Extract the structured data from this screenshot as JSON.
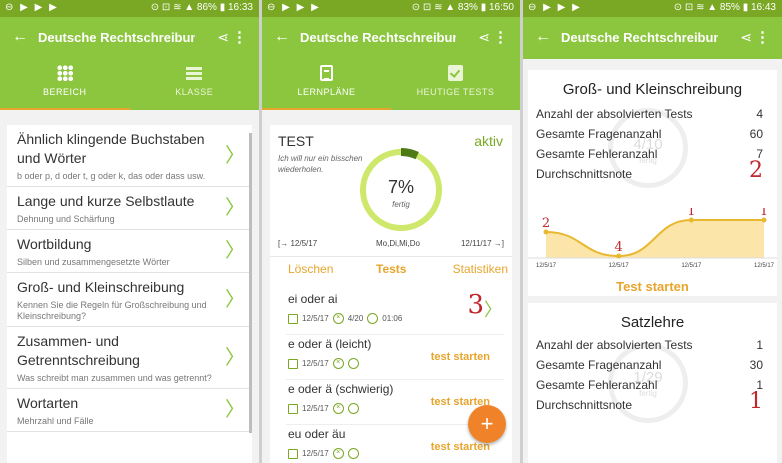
{
  "status_bars": [
    {
      "left": "⊖ ▶ ▶ ▶",
      "right": "⊙ ⊡ ≋ ▲ 86% ▮ 16:33"
    },
    {
      "left": "⊖ ▶ ▶ ▶",
      "right": "⊙ ⊡ ≋ ▲ 83% ▮ 16:50"
    },
    {
      "left": "⊖ ▶ ▶ ▶",
      "right": "⊙ ⊡ ≋ ▲ 85% ▮ 16:43"
    }
  ],
  "app_title": "Deutsche Rechtschreibung",
  "icons": {
    "back": "arrow-back-icon",
    "share": "share-icon",
    "more": "more-vert-icon"
  },
  "glyphs": {
    "back": "←",
    "share": "⋖",
    "more": "⋮",
    "chevron": "〉",
    "fab": "+",
    "arrow_start": "[→",
    "arrow_end": "→]"
  },
  "colors": {
    "primary": "#8cc63f",
    "status": "#7aa824",
    "accent": "#e8a52c",
    "red": "#c0262d",
    "fab": "#f0832a"
  },
  "panel1": {
    "tabs": [
      {
        "label": "BEREICH",
        "icon": "grid-icon",
        "active": true
      },
      {
        "label": "KLASSE",
        "icon": "list-icon",
        "active": false
      }
    ],
    "items": [
      {
        "title": "Ähnlich klingende Buchstaben und Wörter",
        "subtitle": "b oder p, d oder t, g oder k, das oder dass usw."
      },
      {
        "title": "Lange und kurze Selbstlaute",
        "subtitle": "Dehnung und Schärfung"
      },
      {
        "title": "Wortbildung",
        "subtitle": "Silben und zusammengesetzte Wörter"
      },
      {
        "title": "Groß- und Kleinschreibung",
        "subtitle": "Kennen Sie die Regeln für Großschreibung und Kleinschreibung?"
      },
      {
        "title": "Zusammen- und Getrenntschreibung",
        "subtitle": "Was schreibt man zusammen und was getrennt?"
      },
      {
        "title": "Wortarten",
        "subtitle": "Mehrzahl und Fälle"
      }
    ]
  },
  "panel2": {
    "tabs": [
      {
        "label": "LERNPLÄNE",
        "icon": "clipboard-icon",
        "active": true
      },
      {
        "label": "HEUTIGE TESTS",
        "icon": "check-icon",
        "active": false
      }
    ],
    "plan": {
      "title": "TEST",
      "status": "aktiv",
      "description": "Ich will nur ein bisschen wiederholen.",
      "progress_label": "7%",
      "progress_value": 0.07,
      "progress_caption": "fertig",
      "start_date": "12/5/17",
      "days": "Mo,Di,Mi,Do",
      "end_date": "12/11/17",
      "actions": [
        "Löschen",
        "Tests",
        "Statistiken"
      ]
    },
    "tests": [
      {
        "name": "ei oder ai",
        "date": "12/5/17",
        "score": "4/20",
        "time": "01:06",
        "grade": "3",
        "action": ""
      },
      {
        "name": "e oder ä (leicht)",
        "date": "12/5/17",
        "score": "",
        "time": "",
        "grade": "",
        "action": "test starten"
      },
      {
        "name": "e oder ä (schwierig)",
        "date": "12/5/17",
        "score": "",
        "time": "",
        "grade": "",
        "action": "test starten"
      },
      {
        "name": "eu oder äu",
        "date": "12/5/17",
        "score": "",
        "time": "",
        "grade": "",
        "action": "test starten"
      }
    ]
  },
  "panel3": {
    "cards": [
      {
        "title": "Groß- und Kleinschreibung",
        "ghost_label": "4/10",
        "ghost_caption": "fertig",
        "stats": [
          {
            "label": "Anzahl der absolvierten Tests",
            "value": "4"
          },
          {
            "label": "Gesamte Fragenanzahl",
            "value": "60"
          },
          {
            "label": "Gesamte Fehleranzahl",
            "value": "7"
          },
          {
            "label": "Durchschnittsnote",
            "value": "2"
          }
        ],
        "button": "Test starten"
      },
      {
        "title": "Satzlehre",
        "ghost_label": "1/29",
        "ghost_caption": "fertig",
        "stats": [
          {
            "label": "Anzahl der absolvierten Tests",
            "value": "1"
          },
          {
            "label": "Gesamte Fragenanzahl",
            "value": "30"
          },
          {
            "label": "Gesamte Fehleranzahl",
            "value": "1"
          },
          {
            "label": "Durchschnittsnote",
            "value": "1"
          }
        ]
      }
    ]
  },
  "chart_data": {
    "type": "area",
    "categories": [
      "12/5/17",
      "12/5/17",
      "12/5/17",
      "12/5/17"
    ],
    "values": [
      2,
      4,
      1,
      1
    ],
    "data_labels": [
      "2",
      "4",
      "1",
      "1"
    ],
    "xlabel": "",
    "ylabel": "",
    "grid": false
  }
}
